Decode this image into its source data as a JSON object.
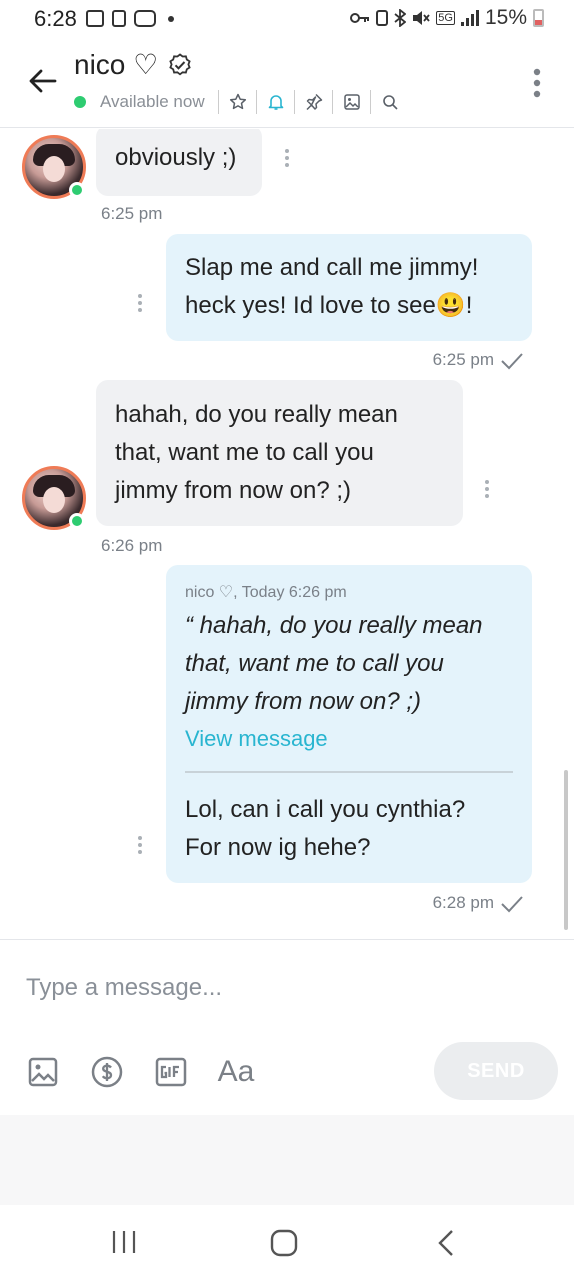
{
  "status_bar": {
    "time": "6:28",
    "network": "5G",
    "battery": "15%"
  },
  "header": {
    "name": "nico ♡",
    "availability": "Available now"
  },
  "messages": [
    {
      "direction": "in",
      "text": "obviously ;)",
      "time": "6:25 pm"
    },
    {
      "direction": "out",
      "lines": [
        "Slap me and call me jimmy!",
        "heck yes! Id love to see😃!"
      ],
      "time": "6:25 pm"
    },
    {
      "direction": "in",
      "lines": [
        "hahah, do you really mean",
        "that, want me to call you",
        "jimmy from now on? ;)"
      ],
      "time": "6:26 pm"
    },
    {
      "direction": "out",
      "quote": {
        "header": "nico ♡, Today 6:26 pm",
        "lines": [
          "“ hahah, do you really mean",
          "that, want me to call you",
          "jimmy from now on? ;)"
        ],
        "link": "View message"
      },
      "lines": [
        "Lol, can i call you cynthia?",
        "For now ig hehe?"
      ],
      "time": "6:28 pm"
    }
  ],
  "composer": {
    "placeholder": "Type a message...",
    "font_tool": "Aa",
    "send_label": "SEND"
  },
  "colors": {
    "outgoing_bubble": "#e4f3fb",
    "incoming_bubble": "#f0f1f3",
    "online": "#2ecc71",
    "link": "#29b5d0",
    "avatar_ring": "#ef7b56"
  }
}
